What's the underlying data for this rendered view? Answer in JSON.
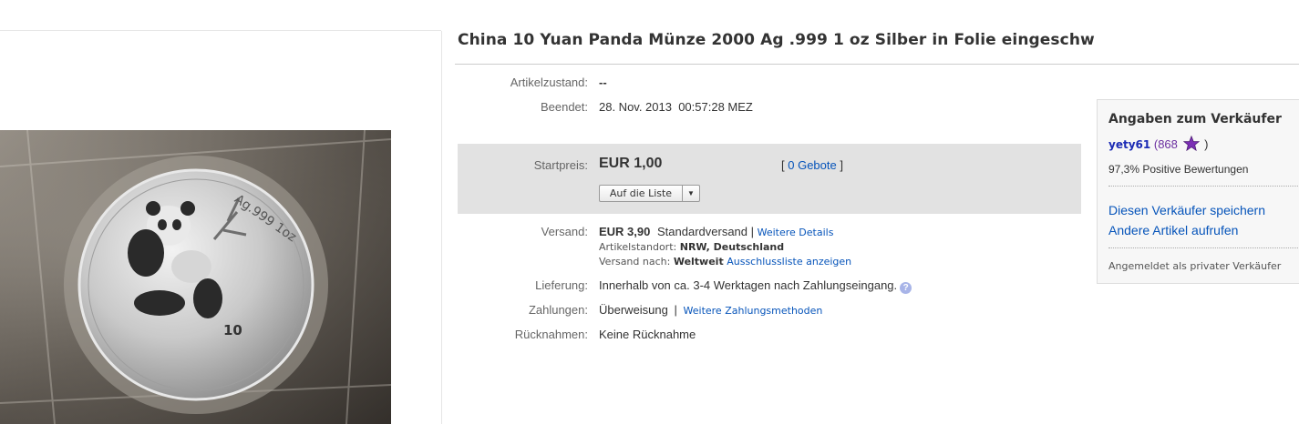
{
  "item": {
    "title": "China 10 Yuan Panda Münze 2000 Ag .999 1 oz Silber in Folie eingeschw",
    "image_alt_text": "Ag.999 1oz"
  },
  "details": {
    "condition_label": "Artikelzustand:",
    "condition_value": "--",
    "ended_label": "Beendet:",
    "ended_value": "28. Nov. 2013  00:57:28 MEZ"
  },
  "pricing": {
    "start_label": "Startpreis:",
    "price": "EUR 1,00",
    "bids_open": "[",
    "bids_link": "0 Gebote",
    "bids_close": "]",
    "watch_button": "Auf die Liste",
    "dropdown_glyph": "▼"
  },
  "shipping": {
    "label": "Versand:",
    "cost": "EUR 3,90",
    "method": "Standardversand |",
    "details_link": "Weitere Details",
    "location_label": "Artikelstandort:",
    "location_value": "NRW, Deutschland",
    "to_label": "Versand nach:",
    "to_value": "Weltweit",
    "exclusion_link": "Ausschlussliste anzeigen"
  },
  "delivery": {
    "label": "Lieferung:",
    "value": "Innerhalb von ca. 3-4 Werktagen nach Zahlungseingang.",
    "help_glyph": "?"
  },
  "payment": {
    "label": "Zahlungen:",
    "value": "Überweisung",
    "separator": "|",
    "more_link": "Weitere Zahlungsmethoden"
  },
  "returns": {
    "label": "Rücknahmen:",
    "value": "Keine Rücknahme"
  },
  "seller": {
    "heading": "Angaben zum Verkäufer",
    "username": "yety61",
    "paren_open": "(",
    "feedback_score": "868",
    "paren_close": ")",
    "positive": "97,3% Positive Bewertungen",
    "save_link": "Diesen Verkäufer speichern",
    "other_items_link": "Andere Artikel aufrufen",
    "private_note": "Angemeldet als privater Verkäufer",
    "star_color": "#7b2fb5"
  }
}
